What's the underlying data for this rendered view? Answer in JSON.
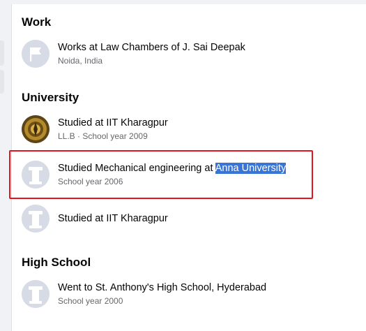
{
  "sections": {
    "work": {
      "title": "Work",
      "entries": [
        {
          "line1": "Works at Law Chambers of J. Sai Deepak",
          "line2": "Noida, India",
          "icon": "flag-icon"
        }
      ]
    },
    "university": {
      "title": "University",
      "entries": [
        {
          "line1": "Studied at IIT Kharagpur",
          "line2": "LL.B · School year 2009",
          "icon": "iit-kharagpur-logo"
        },
        {
          "line1_prefix": "Studied Mechanical engineering at ",
          "line1_selected": "Anna University",
          "line2": "School year 2006",
          "icon": "school-icon"
        },
        {
          "line1": "Studied at IIT Kharagpur",
          "icon": "school-icon"
        }
      ]
    },
    "high_school": {
      "title": "High School",
      "entries": [
        {
          "line1": "Went to St. Anthony's High School, Hyderabad",
          "line2": "School year 2000",
          "icon": "school-icon"
        }
      ]
    }
  },
  "colors": {
    "highlight_border": "#e0161e",
    "selection": "#3875d7",
    "secondary_text": "#65676b"
  }
}
